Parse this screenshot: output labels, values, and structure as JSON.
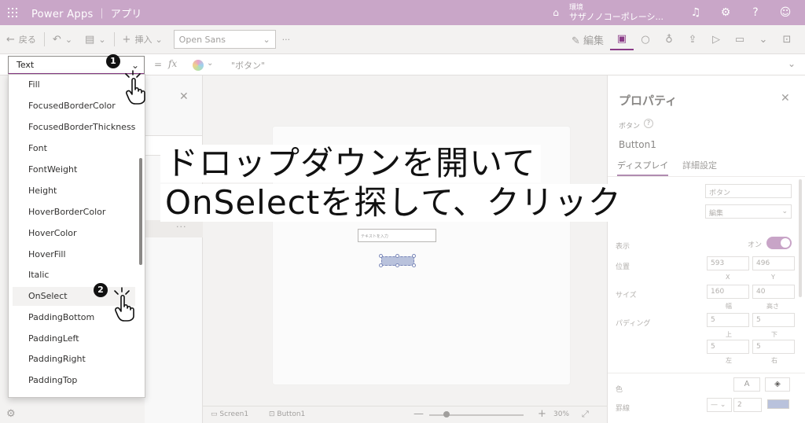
{
  "topbar": {
    "app_title": "Power Apps ｜ アプリ",
    "env_label": "環境",
    "env_name": "サザノノコーポレーシ...",
    "icons": [
      "bell-icon",
      "gear-icon",
      "help-icon",
      "person-icon"
    ]
  },
  "cmdbar": {
    "back": "戻る",
    "insert": "挿入",
    "font": "Open Sans",
    "more": "···",
    "edit": "編集"
  },
  "formula": {
    "property": "Text",
    "equals": "=",
    "fx": "fx",
    "value": "\"ボタン\""
  },
  "dropdown": {
    "items": [
      "Fill",
      "FocusedBorderColor",
      "FocusedBorderThickness",
      "Font",
      "FontWeight",
      "Height",
      "HoverBorderColor",
      "HoverColor",
      "HoverFill",
      "Italic",
      "OnSelect",
      "PaddingBottom",
      "PaddingLeft",
      "PaddingRight",
      "PaddingTop"
    ],
    "highlighted": "OnSelect"
  },
  "caption": {
    "line1": "ドロップダウンを開いて",
    "line2": "OnSelectを探して、クリック"
  },
  "badges": {
    "one": "1",
    "two": "2"
  },
  "canvas": {
    "input_placeholder": "テキストを入力",
    "status_screen": "Screen1",
    "status_button": "Button1",
    "zoom": "30%"
  },
  "props": {
    "title": "プロパティ",
    "type": "ボタン",
    "name": "Button1",
    "tab_display": "ディスプレイ",
    "tab_advanced": "詳細設定",
    "text_value": "ボタン",
    "display_mode": "編集",
    "visible_label": "表示",
    "visible_state": "オン",
    "position_label": "位置",
    "pos_x": "593",
    "pos_y": "496",
    "x_label": "X",
    "y_label": "Y",
    "size_label": "サイズ",
    "width": "160",
    "height": "40",
    "width_label": "幅",
    "height_label": "高さ",
    "padding_label": "パディング",
    "pad_top": "5",
    "pad_bottom": "5",
    "pad_left": "5",
    "pad_right": "5",
    "top_label": "上",
    "bottom_label": "下",
    "left_label": "左",
    "right_label": "右",
    "color_label": "色",
    "font_color_btn": "A",
    "border_label": "罫線",
    "border_width": "2"
  }
}
